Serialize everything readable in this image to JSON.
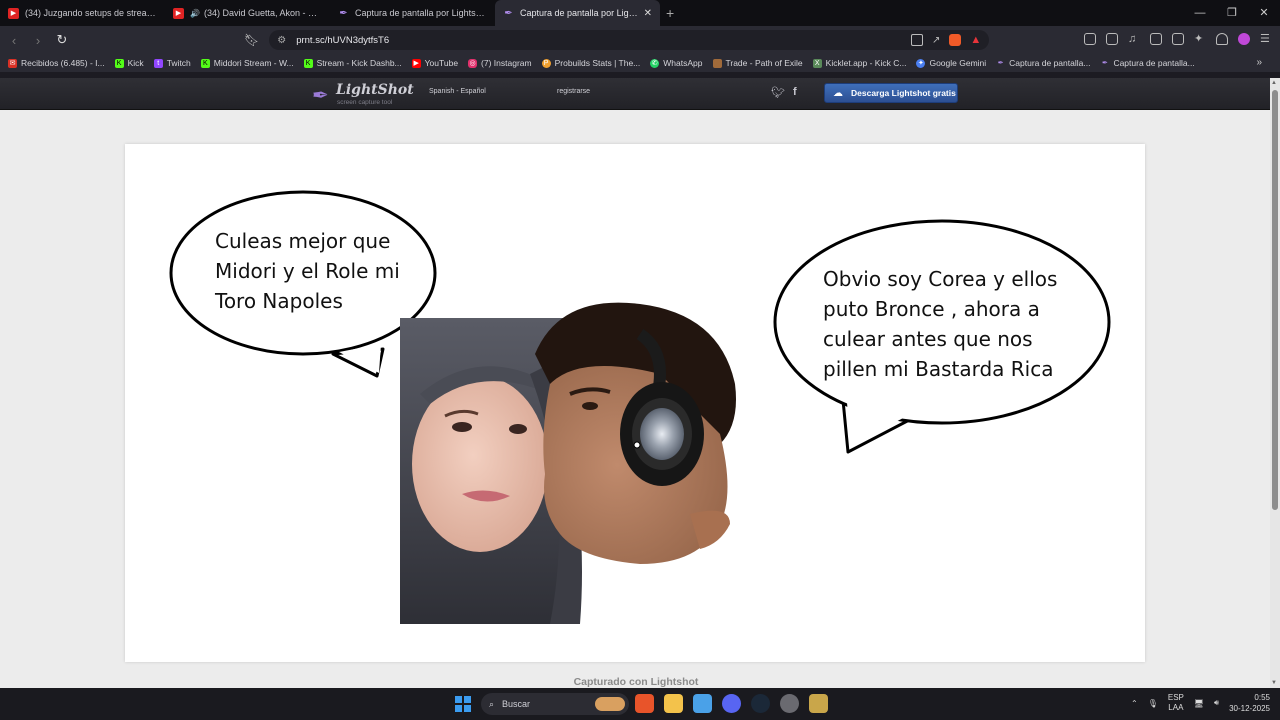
{
  "tabs": [
    {
      "title": "(34) Juzgando setups de streamers",
      "color": "#e02424"
    },
    {
      "title": "(34) David Guetta, Akon - Sexy B",
      "color": "#e02424"
    },
    {
      "title": "Captura de pantalla por Lightshot",
      "color": "#8f6bd4"
    },
    {
      "title": "Captura de pantalla por Lightsh",
      "color": "#8f6bd4",
      "active": true
    }
  ],
  "address": {
    "url": "prnt.sc/hUVN3dytfsT6"
  },
  "bookmarks": [
    {
      "label": "Recibidos (6.485) - I...",
      "color": "#d93025"
    },
    {
      "label": "Kick",
      "color": "#53fc18"
    },
    {
      "label": "Twitch",
      "color": "#9146ff"
    },
    {
      "label": "Middori Stream - W...",
      "color": "#53fc18"
    },
    {
      "label": "Stream - Kick Dashb...",
      "color": "#53fc18"
    },
    {
      "label": "YouTube",
      "color": "#ff0000"
    },
    {
      "label": "(7) Instagram",
      "color": "#e1306c"
    },
    {
      "label": "Probuilds Stats | The...",
      "color": "#f0a030"
    },
    {
      "label": "WhatsApp",
      "color": "#25d366"
    },
    {
      "label": "Trade - Path of Exile",
      "color": "#a06a3a"
    },
    {
      "label": "Kicklet.app - Kick C...",
      "color": "#5a8a5a"
    },
    {
      "label": "Google Gemini",
      "color": "#4a7ef0"
    },
    {
      "label": "Captura de pantalla...",
      "color": "#8f6bd4"
    },
    {
      "label": "Captura de pantalla...",
      "color": "#8f6bd4"
    }
  ],
  "lightshot": {
    "logo": "LightShot",
    "tagline": "screen capture tool",
    "language": "Spanish - Español",
    "register": "registrarse",
    "download": "Descarga Lightshot gratis",
    "caption": "Capturado con Lightshot"
  },
  "meme": {
    "left_bubble": [
      "Culeas mejor que",
      "Midori y el Role mi",
      "Toro Napoles"
    ],
    "right_bubble": [
      "Obvio soy Corea y ellos",
      "puto Bronce , ahora a",
      "culear antes que nos",
      "pillen mi Bastarda Rica"
    ]
  },
  "taskbar": {
    "search_placeholder": "Buscar",
    "lang_top": "ESP",
    "lang_bottom": "LAA",
    "time": "0:55",
    "date": "30-12-2025"
  }
}
